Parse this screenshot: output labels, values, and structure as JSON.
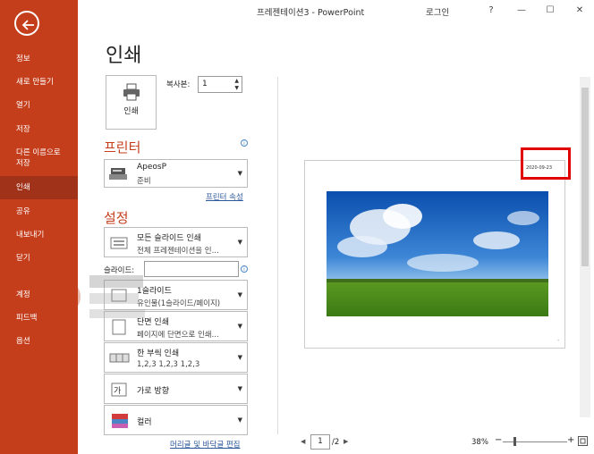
{
  "window": {
    "doc_title": "프레젠테이션3  -  PowerPoint",
    "login": "로그인",
    "help": "?",
    "minimize": "—",
    "maximize": "☐",
    "close": "✕"
  },
  "sidebar": {
    "items": [
      {
        "label": "정보"
      },
      {
        "label": "새로 만들기"
      },
      {
        "label": "열기"
      },
      {
        "label": "저장"
      },
      {
        "label_line1": "다른 이름으로",
        "label_line2": "저장"
      },
      {
        "label": "인쇄"
      },
      {
        "label": "공유"
      },
      {
        "label": "내보내기"
      },
      {
        "label": "닫기"
      },
      {
        "label": "계정"
      },
      {
        "label": "피드백"
      },
      {
        "label": "옵션"
      }
    ]
  },
  "page_title": "인쇄",
  "print": {
    "button_label": "인쇄",
    "copies_label": "복사본:",
    "copies_value": "1"
  },
  "printer": {
    "heading": "프린터",
    "name": "ApeosP",
    "status": "준비",
    "properties_link": "프린터 속성"
  },
  "settings": {
    "heading": "설정",
    "slides_label": "슬라이드:",
    "slides_value": "",
    "options": [
      {
        "line1": "모든 슬라이드 인쇄",
        "line2": "전체 프레젠테이션을 인..."
      },
      {
        "line1": "1슬라이드",
        "line2": "유인물(1슬라이드/페이지)"
      },
      {
        "line1": "단면 인쇄",
        "line2": "페이지에 단면으로 인쇄..."
      },
      {
        "line1": "한 부씩 인쇄",
        "line2": "1,2,3    1,2,3    1,2,3"
      },
      {
        "line1": "가로 방향",
        "line2": ""
      },
      {
        "line1": "컬러",
        "line2": ""
      }
    ],
    "header_footer_link": "머리글 및 바닥글 편집"
  },
  "preview": {
    "date": "2020-09-23",
    "footer_dot": "·",
    "highlight_color": "#e00000"
  },
  "navigation": {
    "prev": "◀",
    "page": "1",
    "total": "/2",
    "next": "▶"
  },
  "zoom": {
    "value": "38%",
    "minus": "−",
    "plus": "+"
  },
  "colors": {
    "accent": "#c43e1c",
    "link": "#2b579a"
  }
}
